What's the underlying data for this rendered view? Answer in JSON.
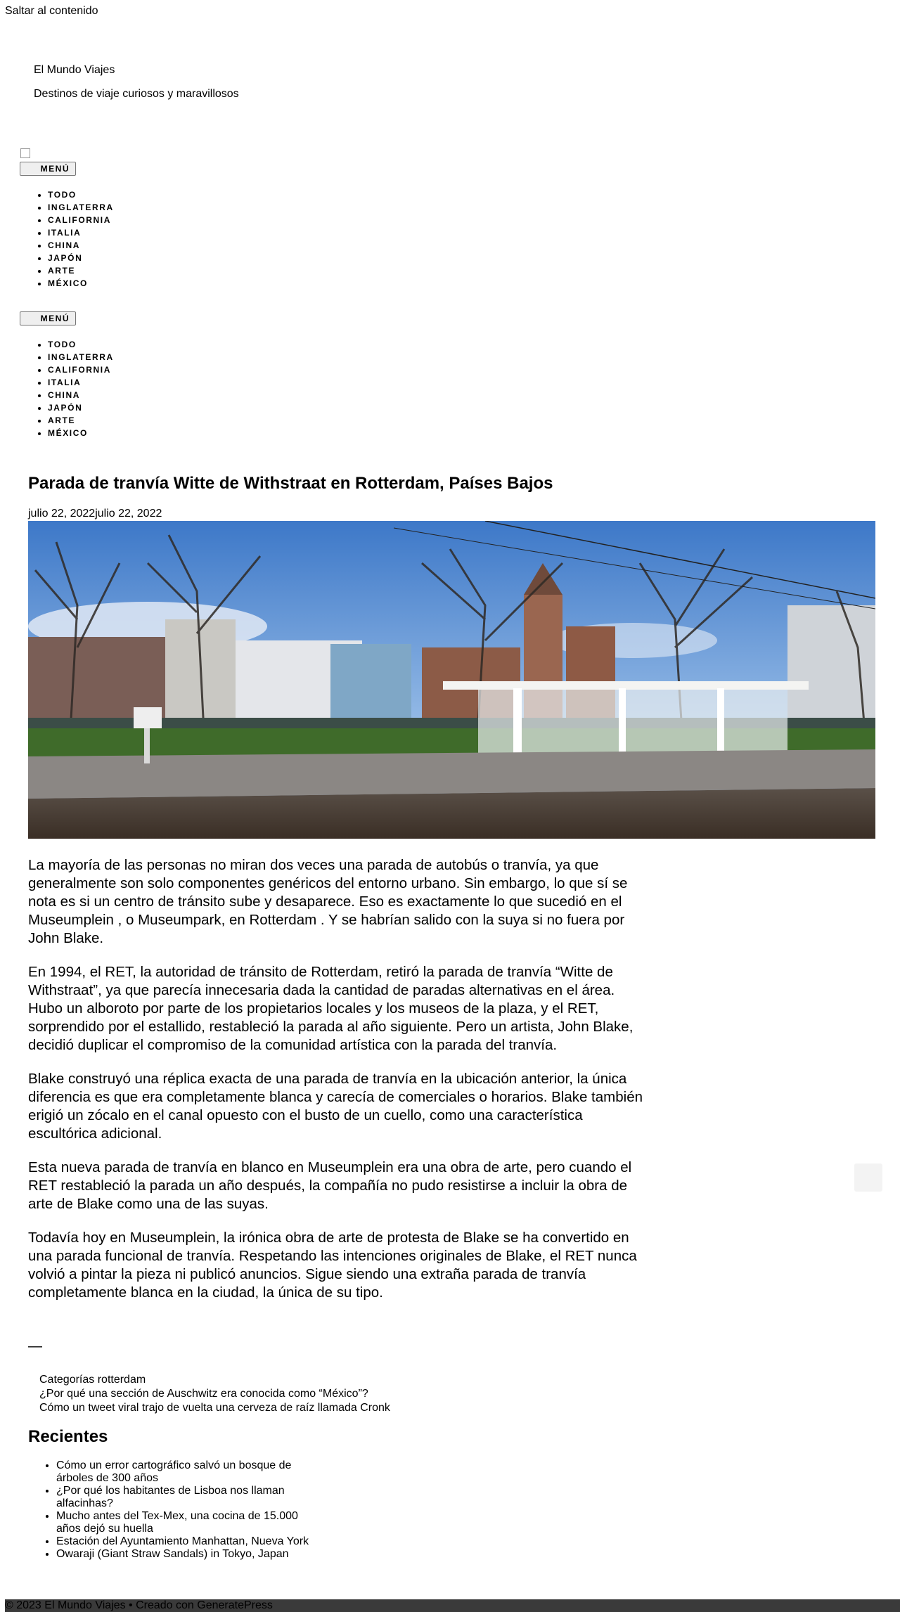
{
  "skip_link": "Saltar al contenido",
  "site": {
    "title": "El Mundo Viajes",
    "description": "Destinos de viaje curiosos y maravillosos"
  },
  "nav_primary": {
    "menu_label": "MENÚ",
    "items": [
      "TODO",
      "INGLATERRA",
      "CALIFORNIA",
      "ITALIA",
      "CHINA",
      "JAPÓN",
      "ARTE",
      "MÉXICO"
    ]
  },
  "nav_secondary": {
    "menu_label": "MENÚ",
    "items": [
      "TODO",
      "INGLATERRA",
      "CALIFORNIA",
      "ITALIA",
      "CHINA",
      "JAPÓN",
      "ARTE",
      "MÉXICO"
    ]
  },
  "post": {
    "title": "Parada de tranvía Witte de Withstraat en Rotterdam, Países Bajos",
    "date": "julio 22, 2022julio 22, 2022",
    "paragraphs": [
      "La mayoría de las personas no miran dos veces una parada de autobús o tranvía, ya que generalmente son solo componentes genéricos del entorno urbano. Sin embargo, lo que sí se nota es si un centro de tránsito sube y desaparece. Eso es exactamente lo que sucedió en el Museumplein , o Museumpark, en Rotterdam . Y se habrían salido con la suya si no fuera por John Blake.",
      "En 1994, el RET, la autoridad de tránsito de Rotterdam, retiró la parada de tranvía “Witte de Withstraat”, ya que parecía innecesaria dada la cantidad de paradas alternativas en el área. Hubo un alboroto por parte de los propietarios locales y los museos de la plaza, y el RET, sorprendido por el estallido, restableció la parada al año siguiente. Pero un artista, John Blake, decidió duplicar el compromiso de la comunidad artística con la parada del tranvía.",
      "Blake construyó una réplica exacta de una parada de tranvía en la ubicación anterior, la única diferencia es que era completamente blanca y carecía de comerciales o horarios. Blake también erigió un zócalo en el canal opuesto con el busto de un cuello, como una característica escultórica adicional.",
      "Esta nueva parada de tranvía en blanco en Museumplein era una obra de arte, pero cuando el RET restableció la parada un año después, la compañía no pudo resistirse a incluir la obra de arte de Blake como una de las suyas.",
      "Todavía hoy en Museumplein, la irónica obra de arte de protesta de Blake se ha convertido en una parada funcional de tranvía. Respetando las intenciones originales de Blake, el RET nunca volvió a pintar la pieza ni publicó anuncios. Sigue siendo una extraña parada de tranvía completamente blanca en la ciudad, la única de su tipo."
    ],
    "separator": "—",
    "categories": "Categorías rotterdam",
    "prev_post": "¿Por qué una sección de Auschwitz era conocida como “México”?",
    "next_post": "Cómo un tweet viral trajo de vuelta una cerveza de raíz llamada Cronk"
  },
  "recent": {
    "heading": "Recientes",
    "items": [
      "Cómo un error cartográfico salvó un bosque de árboles de 300 años",
      "¿Por qué los habitantes de Lisboa nos llaman alfacinhas?",
      "Mucho antes del Tex-Mex, una cocina de 15.000 años dejó su huella",
      "Estación del Ayuntamiento Manhattan, Nueva York",
      "Owaraji (Giant Straw Sandals) in Tokyo, Japan"
    ]
  },
  "footer": {
    "text": "© 2023 El Mundo Viajes • Creado con GeneratePress"
  },
  "colors": {
    "footer_bg": "#3a3a3a",
    "button_bg": "#efefef"
  }
}
